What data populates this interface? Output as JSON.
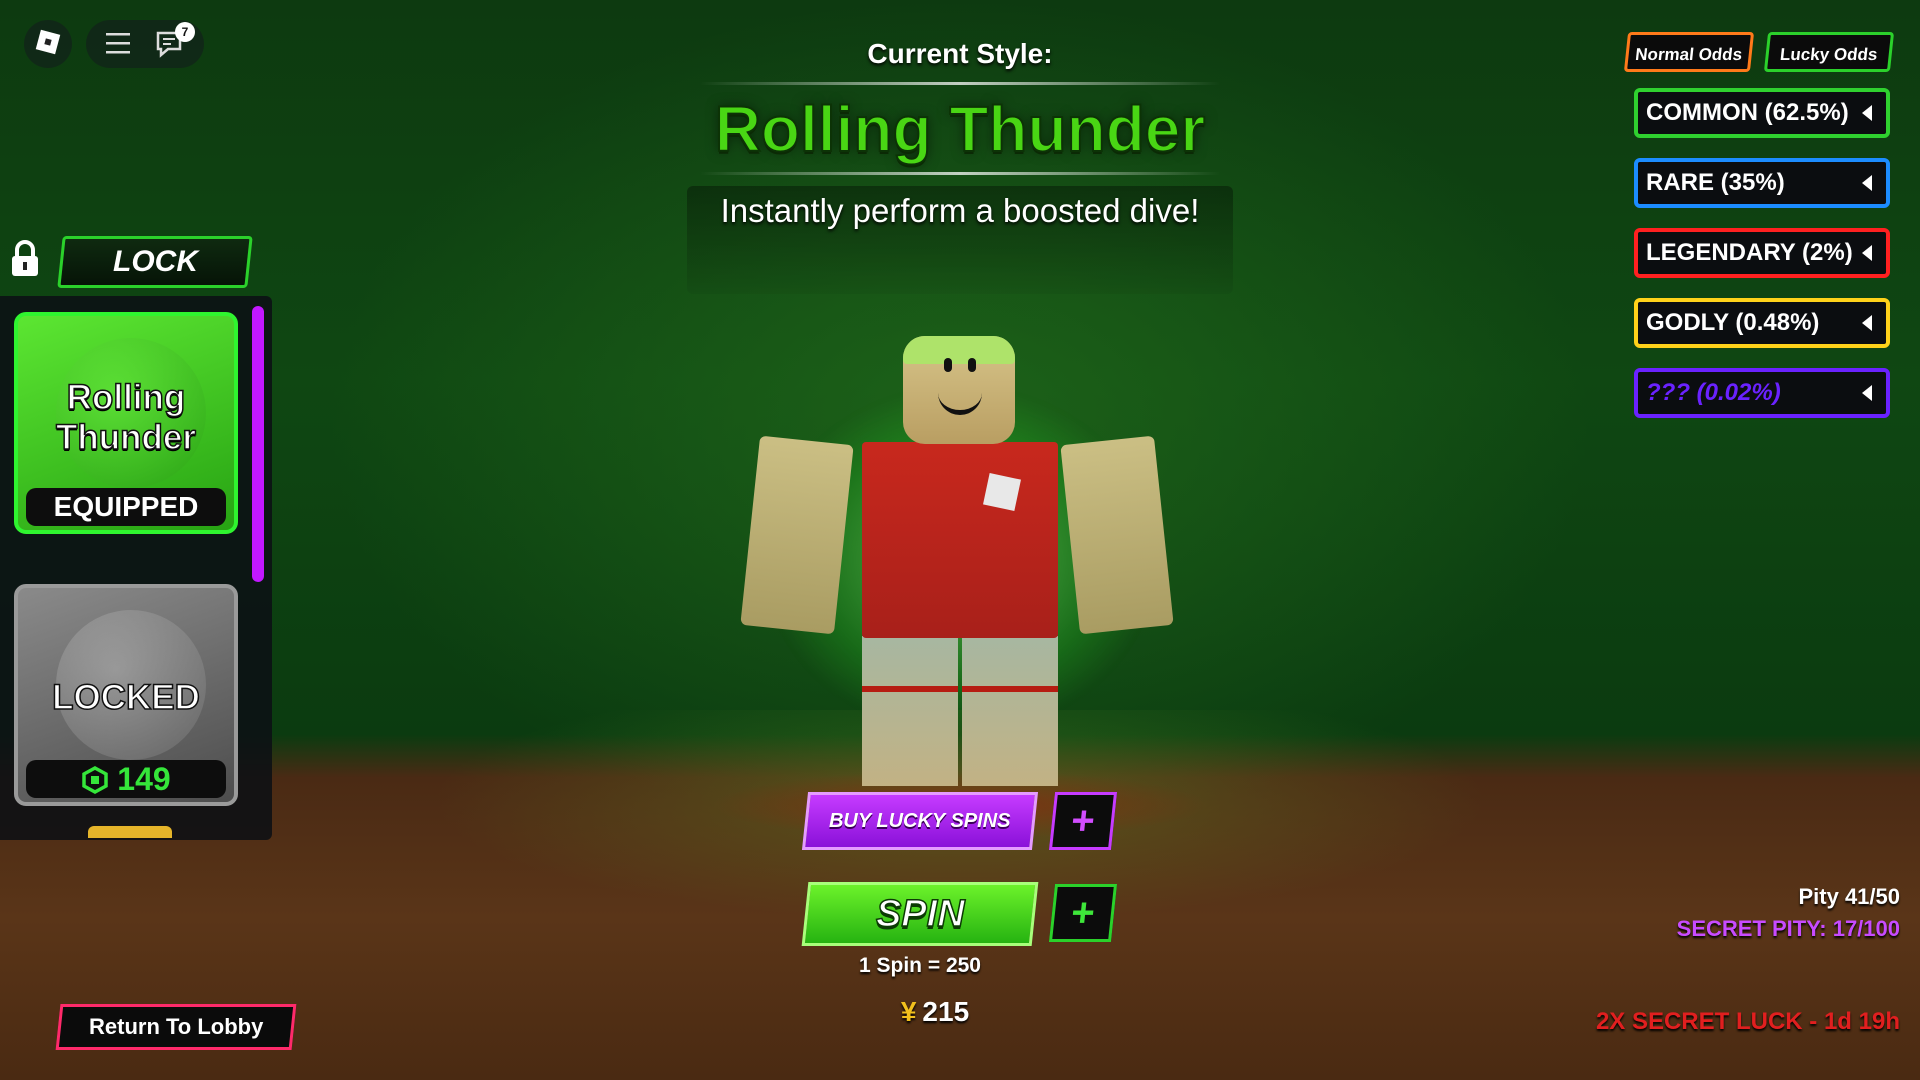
{
  "topbar": {
    "notification_count": "7"
  },
  "header": {
    "current_style_label": "Current Style:",
    "style_name": "Rolling Thunder",
    "description": "Instantly perform a boosted dive!"
  },
  "left_panel": {
    "lock_label": "LOCK",
    "cards": [
      {
        "name": "Rolling Thunder",
        "status": "EQUIPPED"
      },
      {
        "status": "LOCKED",
        "price": "149"
      }
    ]
  },
  "odds": {
    "tabs": [
      "Normal Odds",
      "Lucky Odds"
    ],
    "rows": [
      {
        "label": "COMMON (62.5%)",
        "color": "#2fd12f"
      },
      {
        "label": "RARE (35%)",
        "color": "#1c8cff"
      },
      {
        "label": "LEGENDARY (2%)",
        "color": "#ff2020"
      },
      {
        "label": "GODLY (0.48%)",
        "color": "#ffd21a"
      },
      {
        "label": "??? (0.02%)",
        "color": "#6a22ff"
      }
    ]
  },
  "actions": {
    "buy_lucky_spins": "BUY LUCKY SPINS",
    "plus": "+",
    "spin": "SPIN",
    "spin_cost": "1 Spin = 250",
    "currency_symbol": "¥",
    "balance": "215",
    "return_to_lobby": "Return To Lobby"
  },
  "status": {
    "pity": "Pity 41/50",
    "secret_pity": "SECRET PITY: 17/100",
    "secret_luck": "2X SECRET LUCK - 1d 19h"
  },
  "colors": {
    "accent_green": "#49d614",
    "accent_purple": "#c63bff",
    "lobby_pink": "#ff2a6a"
  }
}
